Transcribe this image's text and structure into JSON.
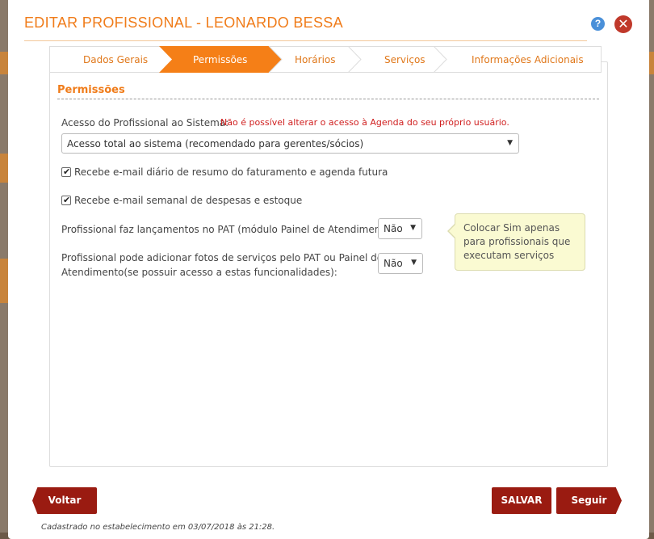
{
  "modal": {
    "title": "EDITAR PROFISSIONAL - LEONARDO BESSA",
    "help_icon": "?",
    "close_icon": "✕"
  },
  "tabs": [
    {
      "label": "Dados Gerais",
      "active": false
    },
    {
      "label": "Permissões",
      "active": true
    },
    {
      "label": "Horários",
      "active": false
    },
    {
      "label": "Serviços",
      "active": false
    },
    {
      "label": "Informações Adicionais",
      "active": false
    }
  ],
  "section": {
    "title": "Permissões"
  },
  "access": {
    "label": "Acesso do Profissional ao Sistema:",
    "warning": "Não é possível alterar o acesso à Agenda do seu próprio usuário.",
    "selected": "Acesso total ao sistema (recomendado para gerentes/sócios)"
  },
  "checkboxes": [
    {
      "label": "Recebe e-mail diário de resumo do faturamento e agenda futura",
      "checked": true
    },
    {
      "label": "Recebe e-mail semanal de despesas e estoque",
      "checked": true
    }
  ],
  "pat": {
    "label": "Profissional faz lançamentos no PAT (módulo Painel de Atendimento):",
    "selected": "Não"
  },
  "photos": {
    "label_line1": "Profissional pode adicionar fotos de serviços pelo PAT ou Painel de",
    "label_line2": "Atendimento(se possuir acesso a estas funcionalidades):",
    "selected": "Não"
  },
  "tooltip": {
    "text": "Colocar Sim apenas para profissionais que executam serviços"
  },
  "buttons": {
    "back": "Voltar",
    "save": "SALVAR",
    "next": "Seguir"
  },
  "footer": {
    "note": "Cadastrado no estabelecimento em 03/07/2018 às 21:28."
  },
  "colors": {
    "accent": "#f07c1a",
    "button": "#9a1b11",
    "warning": "#d01f1f",
    "tooltip_bg": "#fafad2"
  }
}
